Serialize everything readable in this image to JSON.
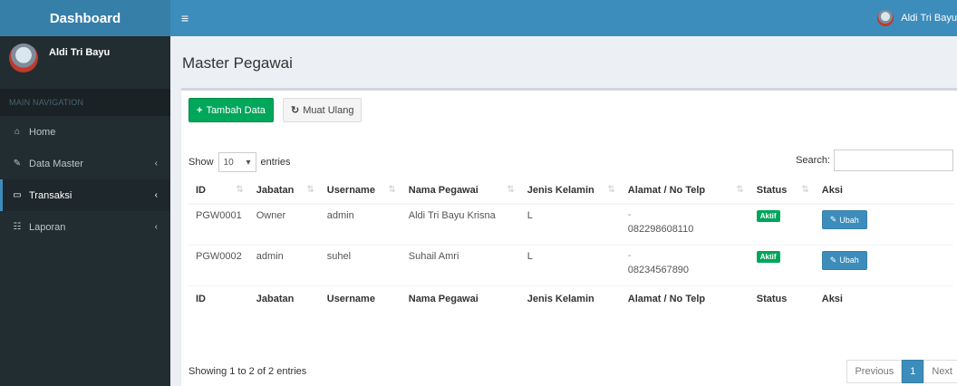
{
  "brand": {
    "logo": "Dashboard"
  },
  "user": {
    "name": "Aldi Tri Bayu",
    "top_name": "Aldi Tri Bayu"
  },
  "sidebar": {
    "header": "MAIN NAVIGATION",
    "items": [
      {
        "label": "Home",
        "icon": "home-icon",
        "icon_glyph": "⌂"
      },
      {
        "label": "Data Master",
        "icon": "edit-icon",
        "icon_glyph": "✎"
      },
      {
        "label": "Transaksi",
        "icon": "laptop-icon",
        "icon_glyph": "▭"
      },
      {
        "label": "Laporan",
        "icon": "reports-icon",
        "icon_glyph": "☷"
      }
    ],
    "chevron": "‹"
  },
  "topbar": {
    "hamburger": "≡"
  },
  "page": {
    "title": "Master Pegawai"
  },
  "toolbar": {
    "add_icon": "+",
    "add_label": "Tambah Data",
    "reload_icon": "↻",
    "reload_label": "Muat Ulang"
  },
  "table_controls": {
    "show_label": "Show",
    "entries_value": "10",
    "entries_arrow": "▾",
    "entries_label": "entries",
    "search_label": "Search:"
  },
  "table": {
    "columns": [
      "ID",
      "Jabatan",
      "Username",
      "Nama Pegawai",
      "Jenis Kelamin",
      "Alamat / No Telp",
      "Status",
      "Aksi"
    ],
    "rows": [
      {
        "id": "PGW0001",
        "jabatan": "Owner",
        "username": "admin",
        "nama": "Aldi Tri Bayu Krisna",
        "jk": "L",
        "alamat": "-",
        "telp": "082298608110",
        "status": "Aktif",
        "aksi": "Ubah"
      },
      {
        "id": "PGW0002",
        "jabatan": "admin",
        "username": "suhel",
        "nama": "Suhail Amri",
        "jk": "L",
        "alamat": "-",
        "telp": "08234567890",
        "status": "Aktif",
        "aksi": "Ubah"
      }
    ]
  },
  "footer": {
    "info": "Showing 1 to 2 of 2 entries",
    "previous": "Previous",
    "current_page": "1",
    "next": "Next"
  },
  "colors": {
    "primary": "#3c8dbc",
    "success": "#00a65a",
    "sidebar": "#222d32"
  }
}
